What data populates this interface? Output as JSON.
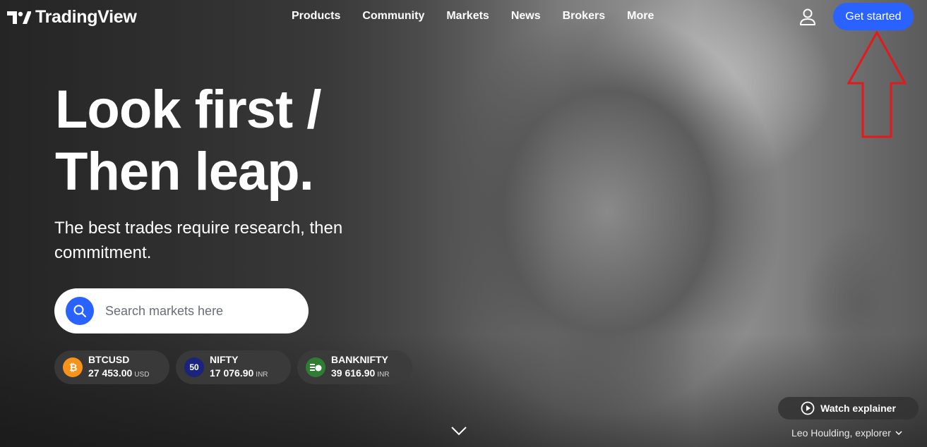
{
  "brand": {
    "name": "TradingView"
  },
  "nav": {
    "items": [
      "Products",
      "Community",
      "Markets",
      "News",
      "Brokers",
      "More"
    ]
  },
  "header": {
    "cta_label": "Get started",
    "user_icon": "user-icon"
  },
  "hero": {
    "headline_line1": "Look first /",
    "headline_line2": "Then leap.",
    "subheadline": "The best trades require research, then commitment."
  },
  "search": {
    "placeholder": "Search markets here",
    "icon": "search-icon"
  },
  "tickers": [
    {
      "symbol": "BTCUSD",
      "price": "27 453.00",
      "currency": "USD",
      "icon_color": "#f7931a",
      "icon_text": ""
    },
    {
      "symbol": "NIFTY",
      "price": "17 076.90",
      "currency": "INR",
      "icon_color": "#1a237e",
      "icon_text": "50"
    },
    {
      "symbol": "BANKNIFTY",
      "price": "39 616.90",
      "currency": "INR",
      "icon_color": "#2e7d32",
      "icon_text": ""
    }
  ],
  "video": {
    "watch_label": "Watch explainer",
    "credit": "Leo Houlding, explorer"
  },
  "colors": {
    "accent": "#2962ff",
    "annotation_arrow": "#e3191c"
  }
}
